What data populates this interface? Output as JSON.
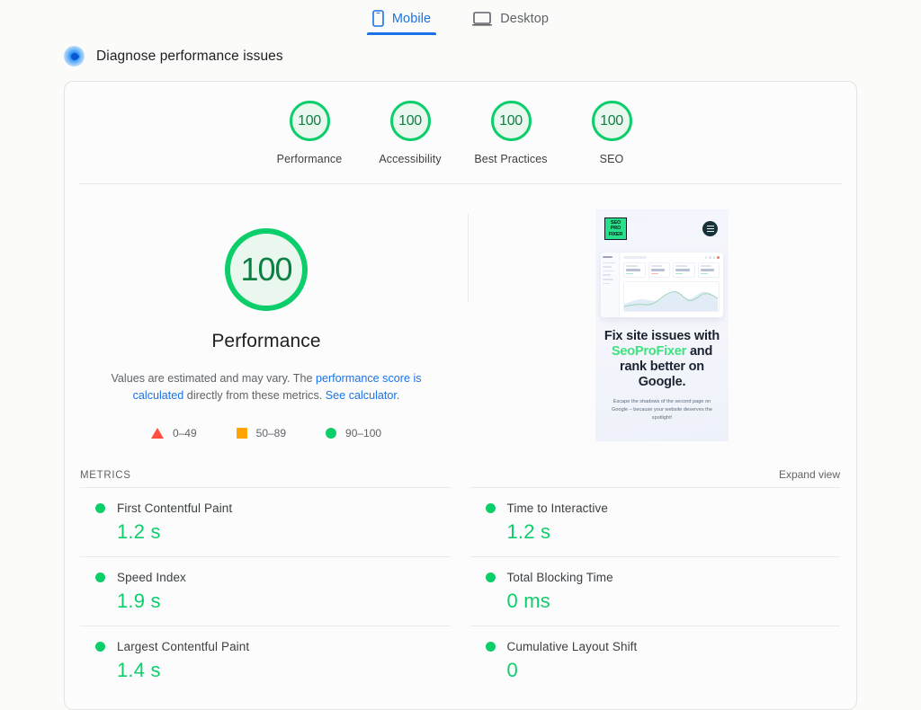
{
  "tabs": [
    {
      "label": "Mobile",
      "icon": "mobile-icon",
      "active": true
    },
    {
      "label": "Desktop",
      "icon": "desktop-icon",
      "active": false
    }
  ],
  "header": {
    "icon": "lighthouse-icon",
    "title": "Diagnose performance issues"
  },
  "categories": [
    {
      "label": "Performance",
      "score": "100"
    },
    {
      "label": "Accessibility",
      "score": "100"
    },
    {
      "label": "Best Practices",
      "score": "100"
    },
    {
      "label": "SEO",
      "score": "100"
    }
  ],
  "hero": {
    "score": "100",
    "title": "Performance",
    "desc_part1": "Values are estimated and may vary. The ",
    "desc_link1": "performance score is calculated",
    "desc_part2": " directly from these metrics. ",
    "desc_link2": "See calculator",
    "desc_part3": "."
  },
  "legend": [
    {
      "shape": "triangle",
      "range": "0–49",
      "color": "#ff4e42"
    },
    {
      "shape": "square",
      "range": "50–89",
      "color": "#ffa400"
    },
    {
      "shape": "circle",
      "range": "90–100",
      "color": "#0cce6b"
    }
  ],
  "ad": {
    "logo_line1": "SEO",
    "logo_line2": "PRO",
    "logo_line3": "FIXER",
    "menu_icon": "hamburger-menu-icon",
    "headline_part1": "Fix site issues with ",
    "headline_brand": "SeoProFixer",
    "headline_part2": " and rank better on Google.",
    "subtext": "Escape the shadows of the second page on Google – because your website deserves the spotlight!",
    "brand_color": "#3ee37f"
  },
  "metrics_section": {
    "title": "METRICS",
    "expand_label": "Expand view"
  },
  "metrics": [
    {
      "name": "First Contentful Paint",
      "value": "1.2 s",
      "status": "good"
    },
    {
      "name": "Time to Interactive",
      "value": "1.2 s",
      "status": "good"
    },
    {
      "name": "Speed Index",
      "value": "1.9 s",
      "status": "good"
    },
    {
      "name": "Total Blocking Time",
      "value": "0 ms",
      "status": "good"
    },
    {
      "name": "Largest Contentful Paint",
      "value": "1.4 s",
      "status": "good"
    },
    {
      "name": "Cumulative Layout Shift",
      "value": "0",
      "status": "good"
    }
  ],
  "colors": {
    "good": "#0cce6b",
    "average": "#ffa400",
    "poor": "#ff4e42",
    "link": "#1a73e8"
  }
}
